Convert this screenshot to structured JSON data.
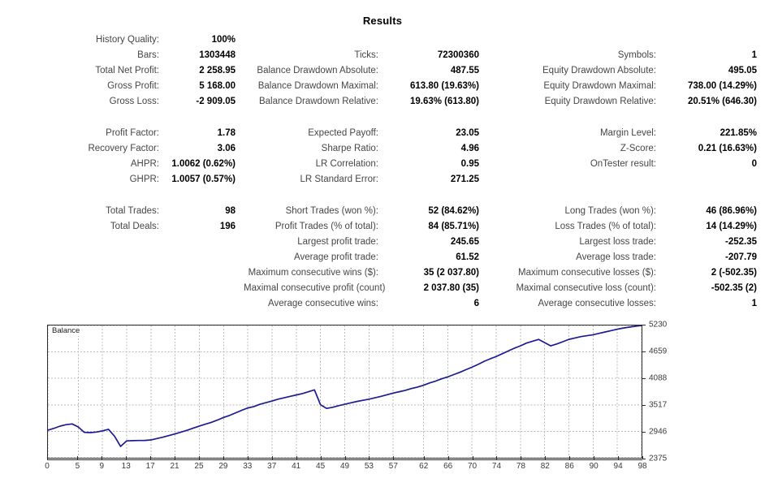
{
  "title": "Results",
  "chart_legend": "Balance",
  "stats": {
    "group1": {
      "col1": [
        {
          "label": "History Quality:",
          "value": "100%"
        },
        {
          "label": "Bars:",
          "value": "1303448"
        },
        {
          "label": "Total Net Profit:",
          "value": "2 258.95"
        },
        {
          "label": "Gross Profit:",
          "value": "5 168.00"
        },
        {
          "label": "Gross Loss:",
          "value": "-2 909.05"
        }
      ],
      "col2": [
        {
          "label": "",
          "value": ""
        },
        {
          "label": "Ticks:",
          "value": "72300360"
        },
        {
          "label": "Balance Drawdown Absolute:",
          "value": "487.55"
        },
        {
          "label": "Balance Drawdown Maximal:",
          "value": "613.80 (19.63%)"
        },
        {
          "label": "Balance Drawdown Relative:",
          "value": "19.63% (613.80)"
        }
      ],
      "col3": [
        {
          "label": "",
          "value": ""
        },
        {
          "label": "Symbols:",
          "value": "1"
        },
        {
          "label": "Equity Drawdown Absolute:",
          "value": "495.05"
        },
        {
          "label": "Equity Drawdown Maximal:",
          "value": "738.00 (14.29%)"
        },
        {
          "label": "Equity Drawdown Relative:",
          "value": "20.51% (646.30)"
        }
      ]
    },
    "group2": {
      "col1": [
        {
          "label": "Profit Factor:",
          "value": "1.78"
        },
        {
          "label": "Recovery Factor:",
          "value": "3.06"
        },
        {
          "label": "AHPR:",
          "value": "1.0062 (0.62%)"
        },
        {
          "label": "GHPR:",
          "value": "1.0057 (0.57%)"
        }
      ],
      "col2": [
        {
          "label": "Expected Payoff:",
          "value": "23.05"
        },
        {
          "label": "Sharpe Ratio:",
          "value": "4.96"
        },
        {
          "label": "LR Correlation:",
          "value": "0.95"
        },
        {
          "label": "LR Standard Error:",
          "value": "271.25"
        }
      ],
      "col3": [
        {
          "label": "Margin Level:",
          "value": "221.85%"
        },
        {
          "label": "Z-Score:",
          "value": "0.21 (16.63%)"
        },
        {
          "label": "OnTester result:",
          "value": "0"
        },
        {
          "label": "",
          "value": ""
        }
      ]
    },
    "group3": {
      "col1": [
        {
          "label": "Total Trades:",
          "value": "98"
        },
        {
          "label": "Total Deals:",
          "value": "196"
        },
        {
          "label": "",
          "value": ""
        },
        {
          "label": "",
          "value": ""
        },
        {
          "label": "",
          "value": ""
        },
        {
          "label": "",
          "value": ""
        },
        {
          "label": "",
          "value": ""
        }
      ],
      "col2": [
        {
          "label": "Short Trades (won %):",
          "value": "52 (84.62%)"
        },
        {
          "label": "Profit Trades (% of total):",
          "value": "84 (85.71%)"
        },
        {
          "label": "Largest profit trade:",
          "value": "245.65"
        },
        {
          "label": "Average profit trade:",
          "value": "61.52"
        },
        {
          "label": "Maximum consecutive wins ($):",
          "value": "35 (2 037.80)"
        },
        {
          "label": "Maximal consecutive profit (count):",
          "value": "2 037.80 (35)"
        },
        {
          "label": "Average consecutive wins:",
          "value": "6"
        }
      ],
      "col3": [
        {
          "label": "Long Trades (won %):",
          "value": "46 (86.96%)"
        },
        {
          "label": "Loss Trades (% of total):",
          "value": "14 (14.29%)"
        },
        {
          "label": "Largest loss trade:",
          "value": "-252.35"
        },
        {
          "label": "Average loss trade:",
          "value": "-207.79"
        },
        {
          "label": "Maximum consecutive losses ($):",
          "value": "2 (-502.35)"
        },
        {
          "label": "Maximal consecutive loss (count):",
          "value": "-502.35 (2)"
        },
        {
          "label": "Average consecutive losses:",
          "value": "1"
        }
      ]
    }
  },
  "chart_data": {
    "type": "line",
    "title": "",
    "legend": [
      "Balance"
    ],
    "legend_position": "top-left",
    "grid": true,
    "xlabel": "",
    "ylabel": "",
    "series_color": "#1c1c8f",
    "xticks": [
      0,
      5,
      9,
      13,
      17,
      21,
      25,
      29,
      33,
      37,
      41,
      45,
      49,
      53,
      57,
      62,
      66,
      70,
      74,
      78,
      82,
      86,
      90,
      94,
      98
    ],
    "yticks": [
      2375,
      2946,
      3517,
      4088,
      4659,
      5230
    ],
    "xlim": [
      0,
      98
    ],
    "ylim": [
      2375,
      5230
    ],
    "series": [
      {
        "name": "Balance",
        "x": [
          0,
          1,
          2,
          3,
          4,
          5,
          6,
          7,
          8,
          9,
          10,
          11,
          12,
          13,
          14,
          15,
          16,
          17,
          18,
          19,
          20,
          21,
          22,
          23,
          24,
          25,
          26,
          27,
          28,
          29,
          30,
          31,
          32,
          33,
          34,
          35,
          36,
          37,
          38,
          39,
          40,
          41,
          42,
          43,
          44,
          45,
          46,
          47,
          48,
          49,
          50,
          51,
          52,
          53,
          54,
          55,
          56,
          57,
          58,
          59,
          60,
          61,
          62,
          63,
          64,
          65,
          66,
          67,
          68,
          69,
          70,
          71,
          72,
          73,
          74,
          75,
          76,
          77,
          78,
          79,
          80,
          81,
          82,
          83,
          84,
          85,
          86,
          87,
          88,
          89,
          90,
          91,
          92,
          93,
          94,
          95,
          96,
          97,
          98
        ],
        "y": [
          2971,
          3010,
          3058,
          3090,
          3105,
          3040,
          2925,
          2918,
          2930,
          2955,
          2990,
          2840,
          2620,
          2740,
          2745,
          2748,
          2750,
          2760,
          2790,
          2820,
          2855,
          2890,
          2930,
          2970,
          3015,
          3060,
          3100,
          3140,
          3190,
          3245,
          3290,
          3345,
          3400,
          3450,
          3480,
          3530,
          3565,
          3600,
          3640,
          3670,
          3700,
          3730,
          3760,
          3800,
          3840,
          3520,
          3440,
          3465,
          3500,
          3530,
          3560,
          3590,
          3615,
          3640,
          3670,
          3700,
          3735,
          3770,
          3800,
          3830,
          3870,
          3900,
          3940,
          3990,
          4030,
          4080,
          4120,
          4170,
          4220,
          4275,
          4330,
          4390,
          4455,
          4510,
          4560,
          4620,
          4680,
          4740,
          4790,
          4850,
          4890,
          4930,
          4860,
          4790,
          4830,
          4880,
          4930,
          4960,
          4990,
          5010,
          5030,
          5060,
          5090,
          5120,
          5150,
          5175,
          5195,
          5215,
          5230
        ]
      }
    ]
  }
}
